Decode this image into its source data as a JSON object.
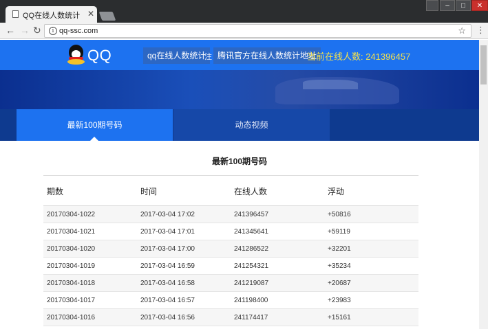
{
  "browser": {
    "tab_title": "QQ在线人数统计",
    "tab_close": "✕",
    "url": "qq-ssc.com"
  },
  "site": {
    "logo_text": "QQ",
    "nav": [
      "qq在线人数统计",
      "腾讯官方在线人数统计地址"
    ],
    "note": "注：",
    "online_label": "当前在线人数: 241396457",
    "tabs": [
      "最新100期号码",
      "动态视频"
    ],
    "active_tab": 0
  },
  "main": {
    "title": "最新100期号码",
    "columns": [
      "期数",
      "时间",
      "在线人数",
      "浮动"
    ],
    "rows": [
      [
        "20170304-1022",
        "2017-03-04 17:02",
        "241396457",
        "+50816"
      ],
      [
        "20170304-1021",
        "2017-03-04 17:01",
        "241345641",
        "+59119"
      ],
      [
        "20170304-1020",
        "2017-03-04 17:00",
        "241286522",
        "+32201"
      ],
      [
        "20170304-1019",
        "2017-03-04 16:59",
        "241254321",
        "+35234"
      ],
      [
        "20170304-1018",
        "2017-03-04 16:58",
        "241219087",
        "+20687"
      ],
      [
        "20170304-1017",
        "2017-03-04 16:57",
        "241198400",
        "+23983"
      ],
      [
        "20170304-1016",
        "2017-03-04 16:56",
        "241174417",
        "+15161"
      ]
    ]
  }
}
